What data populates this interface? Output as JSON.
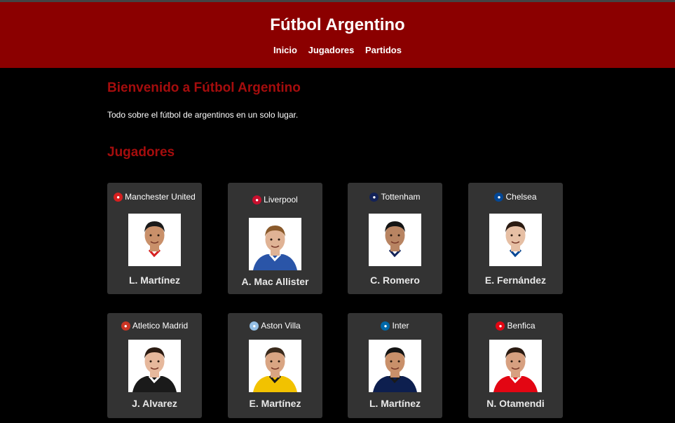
{
  "header": {
    "title": "Fútbol Argentino",
    "nav": [
      "Inicio",
      "Jugadores",
      "Partidos"
    ]
  },
  "welcome": {
    "title": "Bienvenido a Fútbol Argentino",
    "intro": "Todo sobre el fútbol de argentinos en un solo lugar."
  },
  "players_section": {
    "title": "Jugadores",
    "players": [
      {
        "club": "Manchester United",
        "name": "L. Martínez",
        "crest": "manchester-united-crest-icon",
        "crest_color": "#d61f1f",
        "shirt": "#ffffff",
        "trim": "#d61f1f",
        "skin": "#c9906a",
        "hair": "#1a1a1a"
      },
      {
        "club": "Liverpool",
        "name": "A. Mac Allister",
        "crest": "liverpool-crest-icon",
        "crest_color": "#c8102e",
        "shirt": "#2a55a8",
        "trim": "#ffffff",
        "skin": "#e0b395",
        "hair": "#8a5a2b"
      },
      {
        "club": "Tottenham",
        "name": "C. Romero",
        "crest": "tottenham-crest-icon",
        "crest_color": "#132257",
        "shirt": "#ffffff",
        "trim": "#132257",
        "skin": "#b88462",
        "hair": "#141414"
      },
      {
        "club": "Chelsea",
        "name": "E. Fernández",
        "crest": "chelsea-crest-icon",
        "crest_color": "#034694",
        "shirt": "#ffffff",
        "trim": "#034694",
        "skin": "#e6bfa4",
        "hair": "#2b1b12"
      },
      {
        "club": "Atletico Madrid",
        "name": "J. Alvarez",
        "crest": "atletico-madrid-crest-icon",
        "crest_color": "#cb3524",
        "shirt": "#1a1a1a",
        "trim": "#ffffff",
        "skin": "#e6b89c",
        "hair": "#2b1b12"
      },
      {
        "club": "Aston Villa",
        "name": "E. Martínez",
        "crest": "aston-villa-crest-icon",
        "crest_color": "#95bfe5",
        "shirt": "#f2c200",
        "trim": "#1a1a1a",
        "skin": "#d9a583",
        "hair": "#3a2a1c"
      },
      {
        "club": "Inter",
        "name": "L. Martínez",
        "crest": "inter-crest-icon",
        "crest_color": "#0068a8",
        "shirt": "#0d1f4f",
        "trim": "#1a1a1a",
        "skin": "#c9906a",
        "hair": "#141414"
      },
      {
        "club": "Benfica",
        "name": "N. Otamendi",
        "crest": "benfica-crest-icon",
        "crest_color": "#e30613",
        "shirt": "#e30613",
        "trim": "#ffffff",
        "skin": "#d7a080",
        "hair": "#2b1b12"
      }
    ]
  }
}
